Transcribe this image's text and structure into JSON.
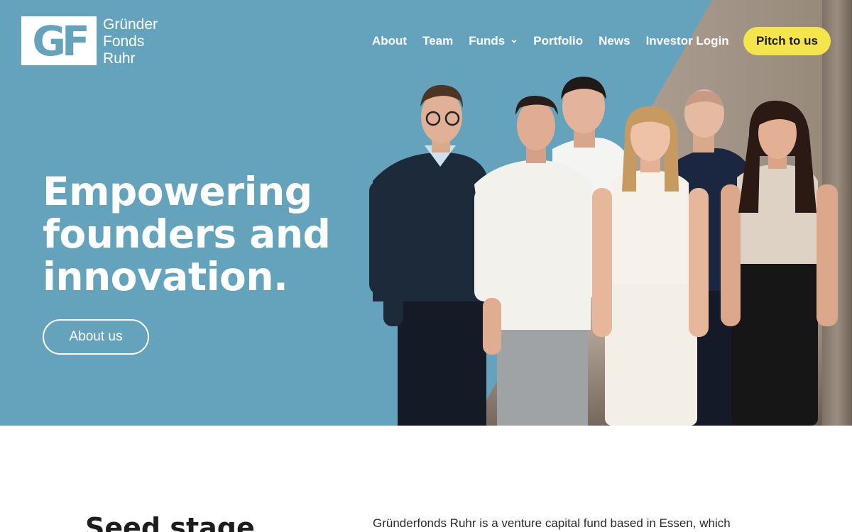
{
  "brand": {
    "logo_mark": "GF",
    "name_lines": [
      "Gründer",
      "Fonds",
      "Ruhr"
    ],
    "colors": {
      "hero_bg": "#64a3bb",
      "accent_yellow": "#f5e54c",
      "text_dark": "#1d1d1d"
    }
  },
  "nav": {
    "items": [
      {
        "label": "About"
      },
      {
        "label": "Team"
      },
      {
        "label": "Funds",
        "icon": "chevron-down-icon"
      },
      {
        "label": "Portfolio"
      },
      {
        "label": "News"
      },
      {
        "label": "Investor Login"
      }
    ],
    "cta_label": "Pitch to us"
  },
  "hero": {
    "headline_lines": [
      "Empowering",
      "founders and",
      "innovation."
    ],
    "button_label": "About us"
  },
  "intro": {
    "title": "Seed stage",
    "text": "Gründerfonds Ruhr is a venture capital fund based in Essen, which"
  }
}
